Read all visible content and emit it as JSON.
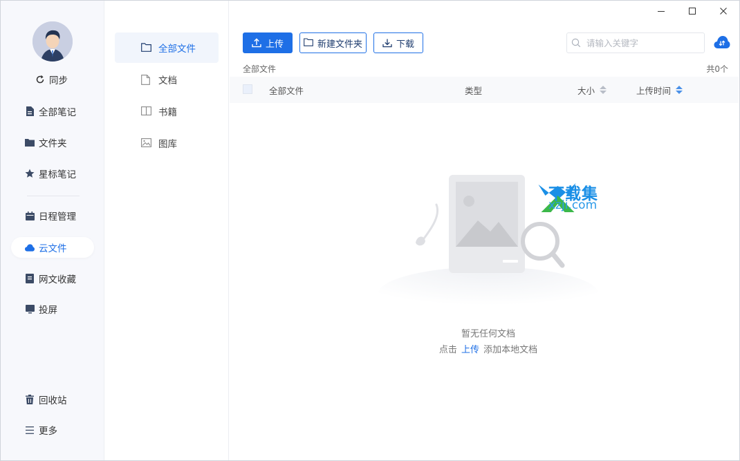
{
  "window": {
    "minimize_icon": "minimize-icon",
    "maximize_icon": "maximize-icon",
    "close_icon": "close-icon"
  },
  "sidebar": {
    "sync_label": "同步",
    "items": [
      {
        "label": "全部笔记",
        "icon": "document-icon"
      },
      {
        "label": "文件夹",
        "icon": "folder-icon"
      },
      {
        "label": "星标笔记",
        "icon": "star-icon"
      },
      {
        "label": "日程管理",
        "icon": "calendar-icon"
      },
      {
        "label": "云文件",
        "icon": "cloud-icon",
        "active": true
      },
      {
        "label": "网文收藏",
        "icon": "bookmark-icon"
      },
      {
        "label": "投屏",
        "icon": "screen-icon"
      }
    ],
    "bottom": [
      {
        "label": "回收站",
        "icon": "trash-icon"
      },
      {
        "label": "更多",
        "icon": "menu-icon"
      }
    ]
  },
  "folders": {
    "items": [
      {
        "label": "全部文件",
        "icon": "folder-outline-icon",
        "active": true
      },
      {
        "label": "文档",
        "icon": "file-icon"
      },
      {
        "label": "书籍",
        "icon": "book-icon"
      },
      {
        "label": "图库",
        "icon": "image-icon"
      }
    ]
  },
  "toolbar": {
    "upload_label": "上传",
    "new_folder_label": "新建文件夹",
    "download_label": "下载",
    "search_placeholder": "请输入关键字"
  },
  "breadcrumb": "全部文件",
  "count_label": "共0个",
  "table": {
    "columns": {
      "name": "全部文件",
      "type": "类型",
      "size": "大小",
      "uploaded": "上传时间"
    }
  },
  "empty": {
    "title": "暂无任何文档",
    "hint_prefix": "点击",
    "hint_link": "上传",
    "hint_suffix": "添加本地文档"
  },
  "watermark": {
    "cn": "下载集",
    "en": "xzji.com"
  },
  "colors": {
    "accent": "#1e6fe6",
    "nav_bg": "#f7f8fc"
  }
}
